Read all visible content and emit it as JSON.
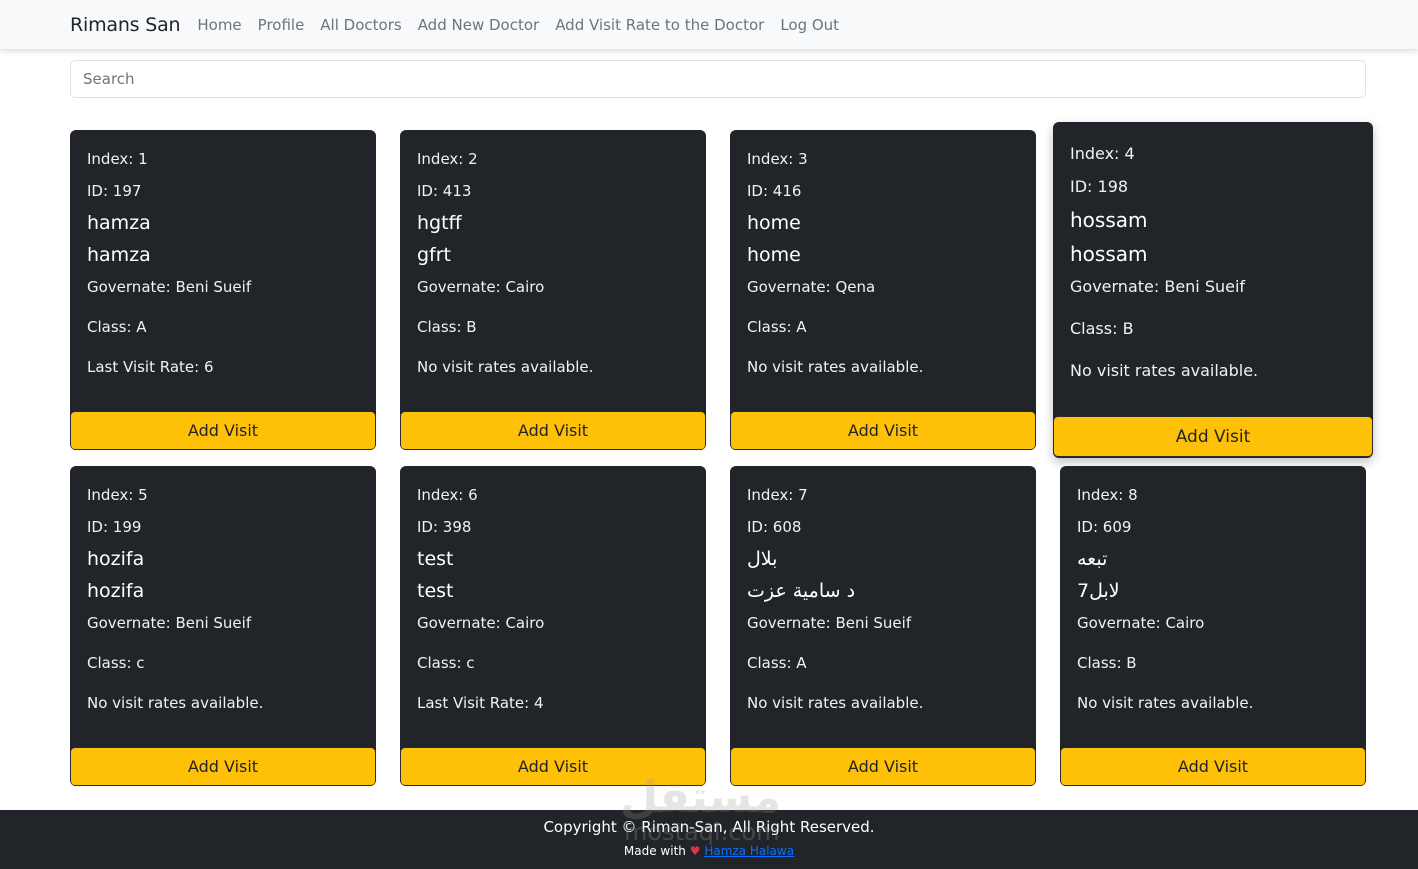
{
  "navbar": {
    "brand": "Rimans San",
    "links": [
      "Home",
      "Profile",
      "All Doctors",
      "Add New Doctor",
      "Add Visit Rate to the Doctor",
      "Log Out"
    ]
  },
  "search": {
    "placeholder": "Search",
    "value": ""
  },
  "cards": [
    {
      "index": "Index: 1",
      "id": "ID: 197",
      "name1": "hamza",
      "name2": "hamza",
      "governate": "Governate: Beni Sueif",
      "class": "Class: A",
      "visit": "Last Visit Rate: 6",
      "button": "Add Visit"
    },
    {
      "index": "Index: 2",
      "id": "ID: 413",
      "name1": "hgtff",
      "name2": "gfrt",
      "governate": "Governate: Cairo",
      "class": "Class: B",
      "visit": "No visit rates available.",
      "button": "Add Visit"
    },
    {
      "index": "Index: 3",
      "id": "ID: 416",
      "name1": "home",
      "name2": "home",
      "governate": "Governate: Qena",
      "class": "Class: A",
      "visit": "No visit rates available.",
      "button": "Add Visit"
    },
    {
      "index": "Index: 4",
      "id": "ID: 198",
      "name1": "hossam",
      "name2": "hossam",
      "governate": "Governate: Beni Sueif",
      "class": "Class: B",
      "visit": "No visit rates available.",
      "button": "Add Visit"
    },
    {
      "index": "Index: 5",
      "id": "ID: 199",
      "name1": "hozifa",
      "name2": "hozifa",
      "governate": "Governate: Beni Sueif",
      "class": "Class: c",
      "visit": "No visit rates available.",
      "button": "Add Visit"
    },
    {
      "index": "Index: 6",
      "id": "ID: 398",
      "name1": "test",
      "name2": "test",
      "governate": "Governate: Cairo",
      "class": "Class: c",
      "visit": "Last Visit Rate: 4",
      "button": "Add Visit"
    },
    {
      "index": "Index: 7",
      "id": "ID: 608",
      "name1": "بلال",
      "name2": "د سامية عزت",
      "governate": "Governate: Beni Sueif",
      "class": "Class: A",
      "visit": "No visit rates available.",
      "button": "Add Visit"
    },
    {
      "index": "Index: 8",
      "id": "ID: 609",
      "name1": "تبعه",
      "name2": "لابل7",
      "governate": "Governate: Cairo",
      "class": "Class: B",
      "visit": "No visit rates available.",
      "button": "Add Visit"
    }
  ],
  "footer": {
    "copyright": "Copyright © Riman-San, All Right Reserved.",
    "made_with": "Made with",
    "heart": "♥",
    "author": "Hamza Halawa"
  },
  "watermark": {
    "arabic": "مستقل",
    "latin": "mostaql.com"
  },
  "colors": {
    "card_bg": "#212529",
    "button_bg": "#ffc107",
    "navbar_bg": "#f8f9fa",
    "footer_bg": "#212529",
    "author_link": "#0d6efd",
    "heart": "#dc3545"
  }
}
